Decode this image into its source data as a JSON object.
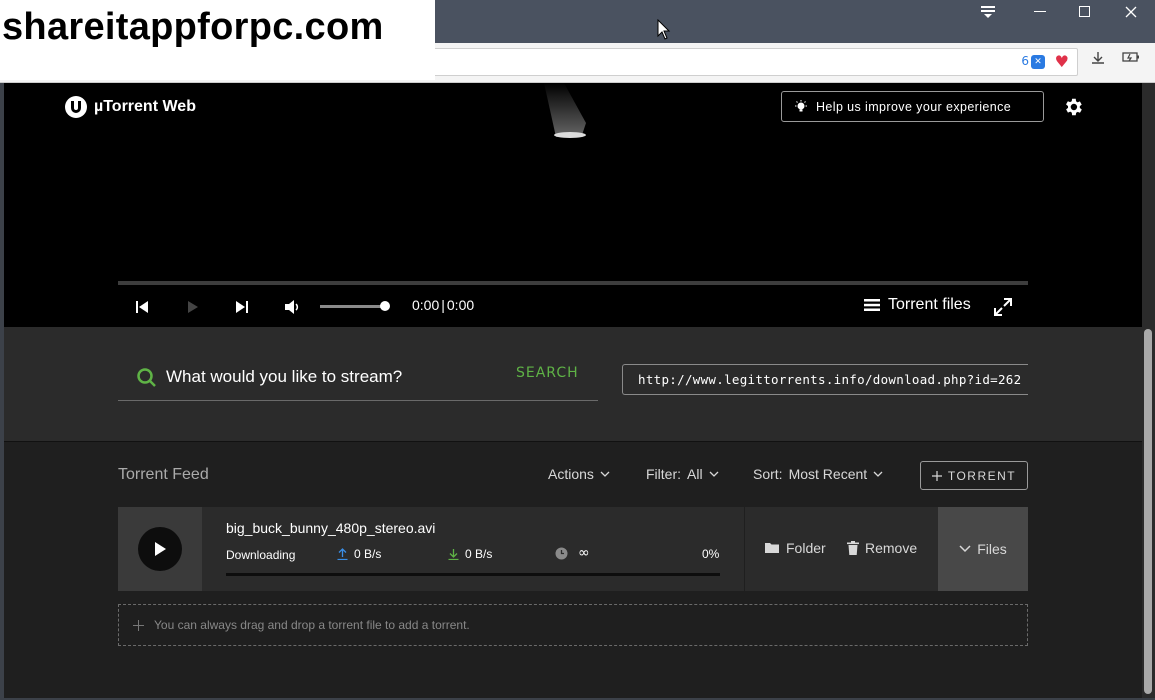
{
  "watermark": {
    "text": "shareitappforpc.com"
  },
  "browser": {
    "shield_count": "6",
    "window_controls": [
      "minimize",
      "maximize",
      "close"
    ]
  },
  "app": {
    "logo_text": "µTorrent Web",
    "help_button": "Help us improve your experience"
  },
  "player": {
    "time_current": "0:00",
    "time_total": "0:00",
    "torrent_files_label": "Torrent files",
    "volume": 1.0,
    "progress": 0
  },
  "search": {
    "placeholder": "What would you like to stream?",
    "button": "SEARCH",
    "url_value": "http://www.legittorrents.info/download.php?id=262"
  },
  "feed": {
    "title": "Torrent Feed",
    "actions_label": "Actions",
    "filter_label": "Filter:",
    "filter_value": "All",
    "sort_label": "Sort:",
    "sort_value": "Most Recent",
    "add_torrent": "TORRENT",
    "items": [
      {
        "name": "big_buck_bunny_480p_stereo.avi",
        "status": "Downloading",
        "upload": "0 B/s",
        "download": "0 B/s",
        "eta": "∞",
        "percent": "0%",
        "progress": 0,
        "folder_label": "Folder",
        "remove_label": "Remove",
        "files_label": "Files"
      }
    ],
    "dropzone": "You can always drag and drop a torrent file to add a torrent."
  },
  "colors": {
    "accent_green": "#5fb346",
    "upload_blue": "#3a8ee6",
    "background": "#1f1f1f",
    "panel": "#2b2b2b"
  }
}
